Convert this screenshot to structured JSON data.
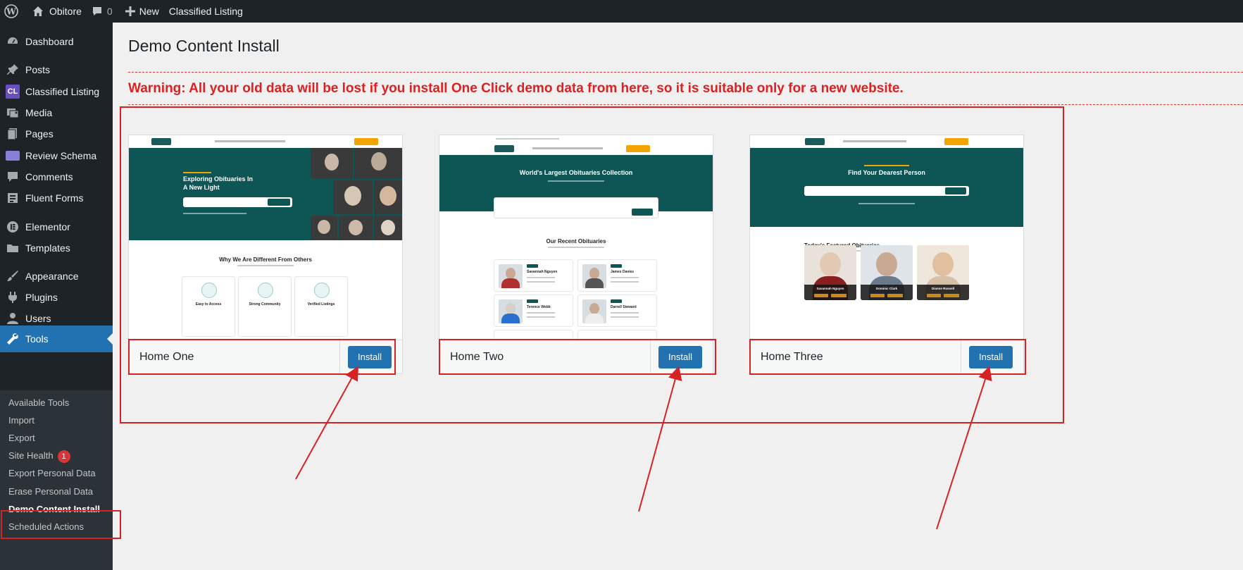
{
  "adminbar": {
    "site_name": "Obitore",
    "comments_count": "0",
    "new_label": "New",
    "classified_label": "Classified Listing"
  },
  "sidebar": {
    "items": [
      {
        "label": "Dashboard",
        "icon": "dashboard-icon"
      },
      {
        "label": "Posts",
        "icon": "pin-icon"
      },
      {
        "label": "Classified Listing",
        "icon": "cl-icon"
      },
      {
        "label": "Media",
        "icon": "media-icon"
      },
      {
        "label": "Pages",
        "icon": "pages-icon"
      },
      {
        "label": "Review Schema",
        "icon": "review-schema-icon"
      },
      {
        "label": "Comments",
        "icon": "comments-icon"
      },
      {
        "label": "Fluent Forms",
        "icon": "forms-icon"
      },
      {
        "label": "Elementor",
        "icon": "elementor-icon"
      },
      {
        "label": "Templates",
        "icon": "folder-icon"
      },
      {
        "label": "Appearance",
        "icon": "brush-icon"
      },
      {
        "label": "Plugins",
        "icon": "plugin-icon"
      },
      {
        "label": "Users",
        "icon": "user-icon"
      },
      {
        "label": "Tools",
        "icon": "wrench-icon"
      }
    ],
    "submenu": [
      {
        "label": "Available Tools"
      },
      {
        "label": "Import"
      },
      {
        "label": "Export"
      },
      {
        "label": "Site Health",
        "badge": "1"
      },
      {
        "label": "Export Personal Data"
      },
      {
        "label": "Erase Personal Data"
      },
      {
        "label": "Demo Content Install"
      },
      {
        "label": "Scheduled Actions"
      }
    ],
    "cl_badge_text": "CL"
  },
  "main": {
    "title": "Demo Content Install",
    "warning": "Warning: All your old data will be lost if you install One Click demo data from here, so it is suitable only for a new website.",
    "demos": [
      {
        "name": "Home One",
        "install_label": "Install",
        "hero_title_1": "Exploring Obituaries In",
        "hero_title_2": "A New Light",
        "section_title": "Why We Are Different From Others",
        "features": [
          "Easy to Access",
          "Strong Community",
          "Verified Listings"
        ]
      },
      {
        "name": "Home Two",
        "install_label": "Install",
        "hero_title": "World's Largest Obituaries Collection",
        "section_title": "Our Recent Obituaries",
        "obituaries": [
          "Savannah Nguyen",
          "James Davies",
          "Terence Webb",
          "Darrell Steward"
        ]
      },
      {
        "name": "Home Three",
        "install_label": "Install",
        "hero_title": "Find Your Dearest Person",
        "section_title": "Today's Featured Obituaries",
        "featured": [
          "Savannah Nguyen",
          "Dominic Clark",
          "Dianne Russell"
        ]
      }
    ]
  },
  "colors": {
    "admin_dark": "#1d2327",
    "accent_blue": "#2271b1",
    "warning_red": "#e02020",
    "annotation_red": "#d62222",
    "hero_teal": "#0e5656"
  }
}
